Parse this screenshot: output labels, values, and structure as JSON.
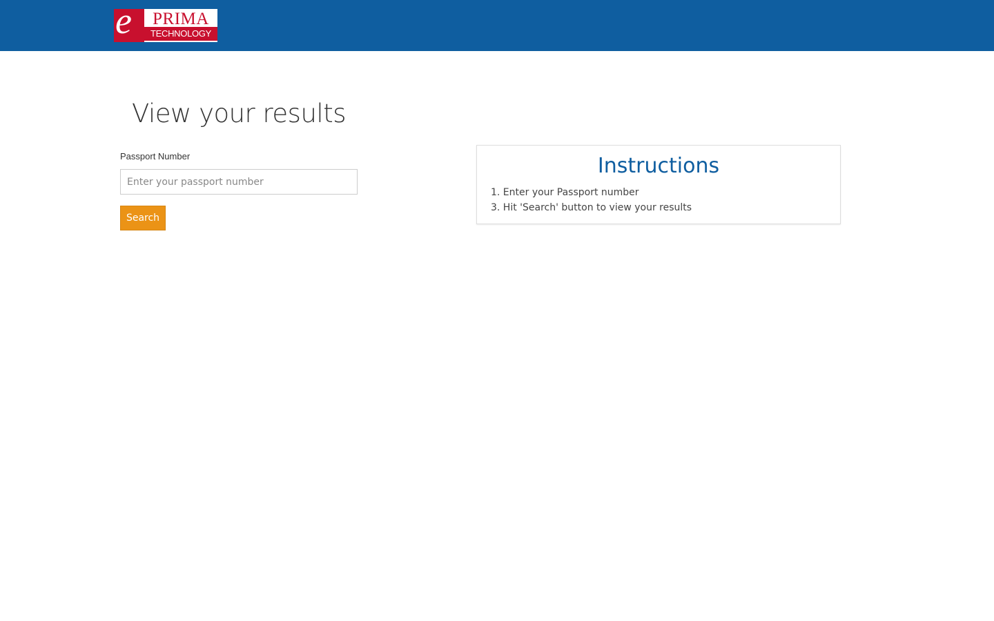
{
  "header": {
    "logo": {
      "letter": "e",
      "brand": "PRIMA",
      "subtitle": "TECHNOLOGY"
    }
  },
  "form": {
    "title": "View your results",
    "passport_label": "Passport Number",
    "passport_placeholder": "Enter your passport number",
    "passport_value": "",
    "search_label": "Search"
  },
  "instructions": {
    "title": "Instructions",
    "steps": [
      "1. Enter your Passport number",
      "3. Hit 'Search' button to view your results"
    ]
  },
  "colors": {
    "header_bg": "#0f5ea0",
    "brand_red": "#c8102e",
    "accent_orange": "#eb9316",
    "instructions_title": "#0f5ea0"
  }
}
